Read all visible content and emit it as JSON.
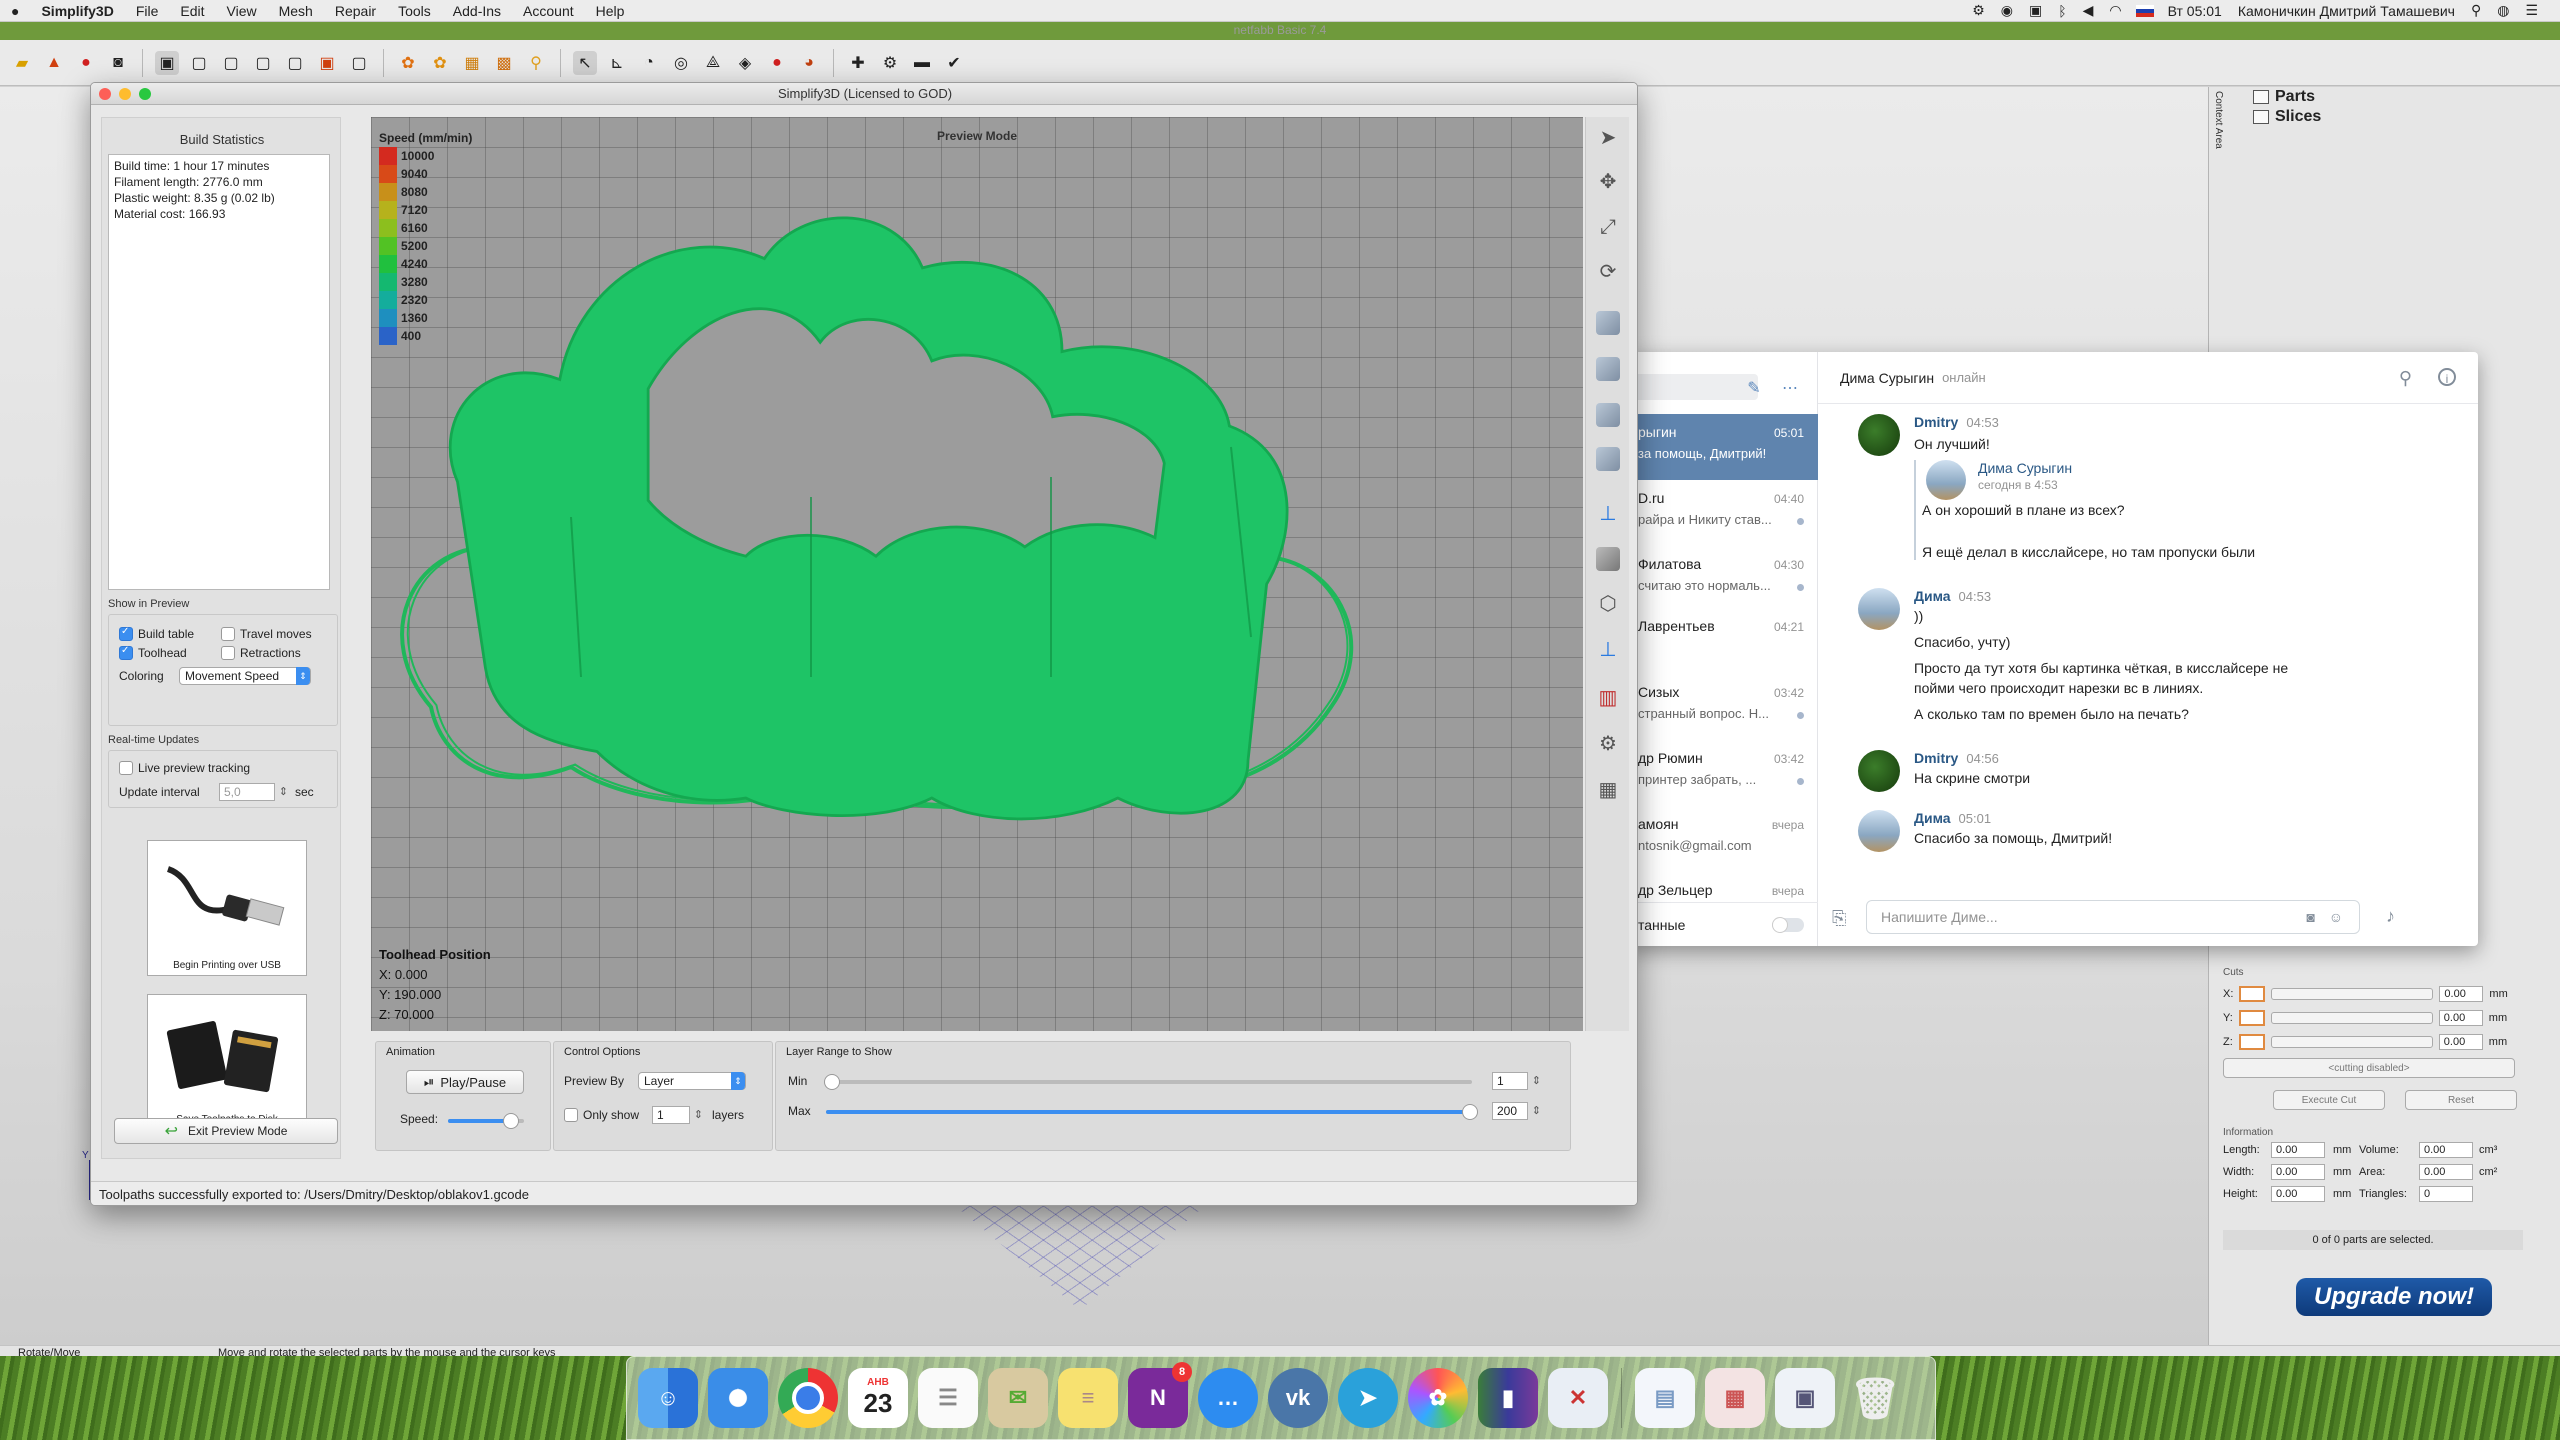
{
  "menubar": {
    "apple": "",
    "app": "Simplify3D",
    "menus": [
      "File",
      "Edit",
      "View",
      "Mesh",
      "Repair",
      "Tools",
      "Add-Ins",
      "Account",
      "Help"
    ],
    "clock": "Вт 05:01",
    "user": "Камоничкин Дмитрий Тамашевич"
  },
  "netfabb": {
    "title": "netfabb Basic 7.4",
    "tree": [
      "Parts",
      "Slices"
    ],
    "side_label": "Context Area",
    "status_left": "Rotate/Move",
    "status_hint": "Move and rotate the selected parts by the mouse and the cursor keys",
    "cuts": {
      "title": "Cuts",
      "rows": [
        {
          "axis": "X:",
          "value": "0.00",
          "unit": "mm"
        },
        {
          "axis": "Y:",
          "value": "0.00",
          "unit": "mm"
        },
        {
          "axis": "Z:",
          "value": "0.00",
          "unit": "mm"
        }
      ],
      "mode": "<cutting disabled>",
      "execute": "Execute Cut",
      "reset": "Reset"
    },
    "information": {
      "title": "Information",
      "length_label": "Length:",
      "length": "0.00",
      "length_unit": "mm",
      "volume_label": "Volume:",
      "volume": "0.00",
      "volume_unit": "cm³",
      "width_label": "Width:",
      "width": "0.00",
      "width_unit": "mm",
      "area_label": "Area:",
      "area": "0.00",
      "area_unit": "cm²",
      "height_label": "Height:",
      "height": "0.00",
      "height_unit": "mm",
      "triangles_label": "Triangles:",
      "triangles": "0",
      "selected": "0 of 0 parts are selected."
    },
    "upgrade": "Upgrade now!"
  },
  "simplify": {
    "title": "Simplify3D (Licensed to GOD)",
    "build_stats_title": "Build Statistics",
    "stats": [
      "Build time: 1 hour 17 minutes",
      "Filament length: 2776.0 mm",
      "Plastic weight: 8.35 g (0.02 lb)",
      "Material cost: 166.93"
    ],
    "show_in_preview": "Show in Preview",
    "options": {
      "build_table": "Build table",
      "travel_moves": "Travel moves",
      "toolhead": "Toolhead",
      "retractions": "Retractions"
    },
    "coloring_label": "Coloring",
    "coloring_value": "Movement Speed",
    "realtime_title": "Real-time Updates",
    "live_tracking": "Live preview tracking",
    "update_interval_label": "Update interval",
    "update_interval": "5,0",
    "update_unit": "sec",
    "card_usb": "Begin Printing over USB",
    "card_sd": "Save Toolpaths to Disk",
    "exit_preview": "Exit Preview Mode",
    "preview_mode": "Preview Mode",
    "legend_title": "Speed (mm/min)",
    "legend": [
      {
        "label": "10000",
        "color": "#d42a1f"
      },
      {
        "label": "9040",
        "color": "#d84a18"
      },
      {
        "label": "8080",
        "color": "#c8901a"
      },
      {
        "label": "7120",
        "color": "#b6b21c"
      },
      {
        "label": "6160",
        "color": "#8cbf1e"
      },
      {
        "label": "5200",
        "color": "#52c224"
      },
      {
        "label": "4240",
        "color": "#20c03e"
      },
      {
        "label": "3280",
        "color": "#14b870"
      },
      {
        "label": "2320",
        "color": "#14ad9c"
      },
      {
        "label": "1360",
        "color": "#1e8fbf"
      },
      {
        "label": "400",
        "color": "#2a63c8"
      }
    ],
    "toolhead_title": "Toolhead Position",
    "toolhead": [
      "X: 0.000",
      "Y: 190.000",
      "Z: 70.000"
    ],
    "animation_title": "Animation",
    "play_pause": "Play/Pause",
    "speed_label": "Speed:",
    "speed_level": 0.82,
    "control_title": "Control Options",
    "preview_by_label": "Preview By",
    "preview_by": "Layer",
    "only_show": "Only show",
    "only_show_value": "1",
    "layers_label": "layers",
    "layer_range_title": "Layer Range to Show",
    "min_label": "Min",
    "min_value": "1",
    "max_label": "Max",
    "max_value": "200",
    "status": "Toolpaths successfully exported to: /Users/Dmitry/Desktop/oblakov1.gcode"
  },
  "vk": {
    "contact": "Дима Сурыгин",
    "presence": "онлайн",
    "dialogs": [
      {
        "name": "рыгин",
        "time": "05:01",
        "preview": "за помощь, Дмитрий!",
        "selected": true
      },
      {
        "name": "D.ru",
        "time": "04:40",
        "preview": "райра и Никиту став..."
      },
      {
        "name": "Филатова",
        "time": "04:30",
        "preview": "считаю это нормаль..."
      },
      {
        "name": "Лаврентьев",
        "time": "04:21",
        "preview": ""
      },
      {
        "name": "Сизых",
        "time": "03:42",
        "preview": "странный вопрос. Н..."
      },
      {
        "name": "др Рюмин",
        "time": "03:42",
        "preview": "принтер забрать, ..."
      },
      {
        "name": "амоян",
        "time": "вчера",
        "preview": "ntosnik@gmail.com"
      },
      {
        "name": "др Зельцер",
        "time": "вчера",
        "preview": ""
      }
    ],
    "unread_only": "танные",
    "messages": [
      {
        "author": "Dmitry",
        "time": "04:53",
        "lines": [
          "Он лучший!"
        ]
      },
      {
        "author": "Дима Сурыгин",
        "time": "сегодня в 4:53",
        "lines": [
          "А он хороший в плане из всех?",
          "Я ещё делал в кисслайсере, но там пропуски были"
        ]
      },
      {
        "author": "Дима",
        "time": "04:53",
        "lines": [
          "))",
          "Спасибо, учту)",
          "Просто да тут хотя бы картинка чёткая, в кисслайсере не",
          "пойми чего происходит нарезки вс в линиях.",
          "А сколько там по времен было на печать?"
        ]
      },
      {
        "author": "Dmitry",
        "time": "04:56",
        "lines": [
          "На скрине смотри"
        ]
      },
      {
        "author": "Дима",
        "time": "05:01",
        "lines": [
          "Спасибо за помощь, Дмитрий!"
        ]
      }
    ],
    "input_placeholder": "Напишите Диме..."
  },
  "dock": {
    "calendar_day": "23",
    "calendar_month": "АНВ",
    "onenote_badge": "8"
  }
}
